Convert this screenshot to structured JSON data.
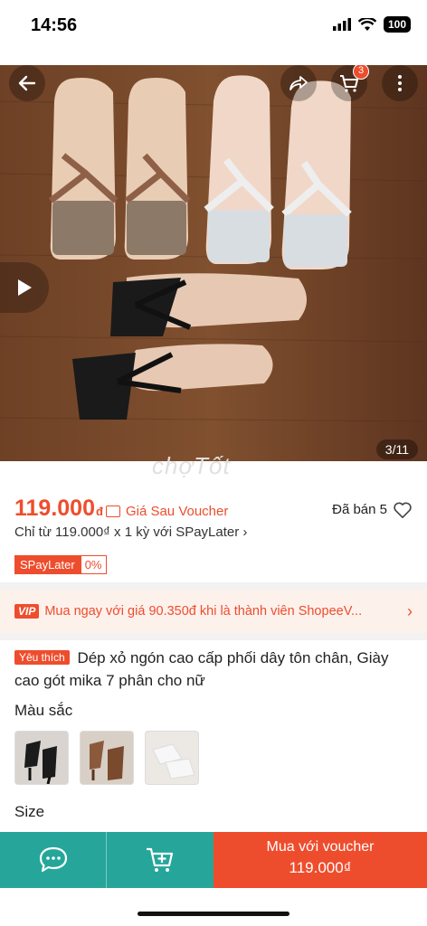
{
  "status_bar": {
    "time": "14:56",
    "battery": "100"
  },
  "gallery": {
    "counter": "3/11",
    "cart_count": "3",
    "watermark": "chợTốt"
  },
  "price": {
    "amount": "119.000",
    "currency": "đ",
    "note": "Giá Sau Voucher"
  },
  "sold": "Đã bán 5",
  "installment": "Chỉ từ 119.000₫ x 1 kỳ với SPayLater ›",
  "spaylater": {
    "left": "SPayLater",
    "right": "0%"
  },
  "vip": {
    "tag": "VIP",
    "text": "Mua ngay với giá 90.350đ khi là thành viên ShopeeV..."
  },
  "product": {
    "badge": "Yêu thích",
    "title": "Dép xỏ ngón cao cấp phối dây tôn chân, Giày cao gót mika 7 phân cho nữ"
  },
  "color_label": "Màu sắc",
  "size_label": "Size",
  "bottom": {
    "buy_label": "Mua với voucher",
    "buy_price": "119.000₫"
  },
  "colors": {
    "accent": "#ee4d2d",
    "teal": "#26a69a"
  },
  "icons": [
    "back-icon",
    "share-icon",
    "cart-icon",
    "more-icon",
    "play-icon",
    "heart-icon",
    "chat-icon",
    "add-cart-icon"
  ]
}
